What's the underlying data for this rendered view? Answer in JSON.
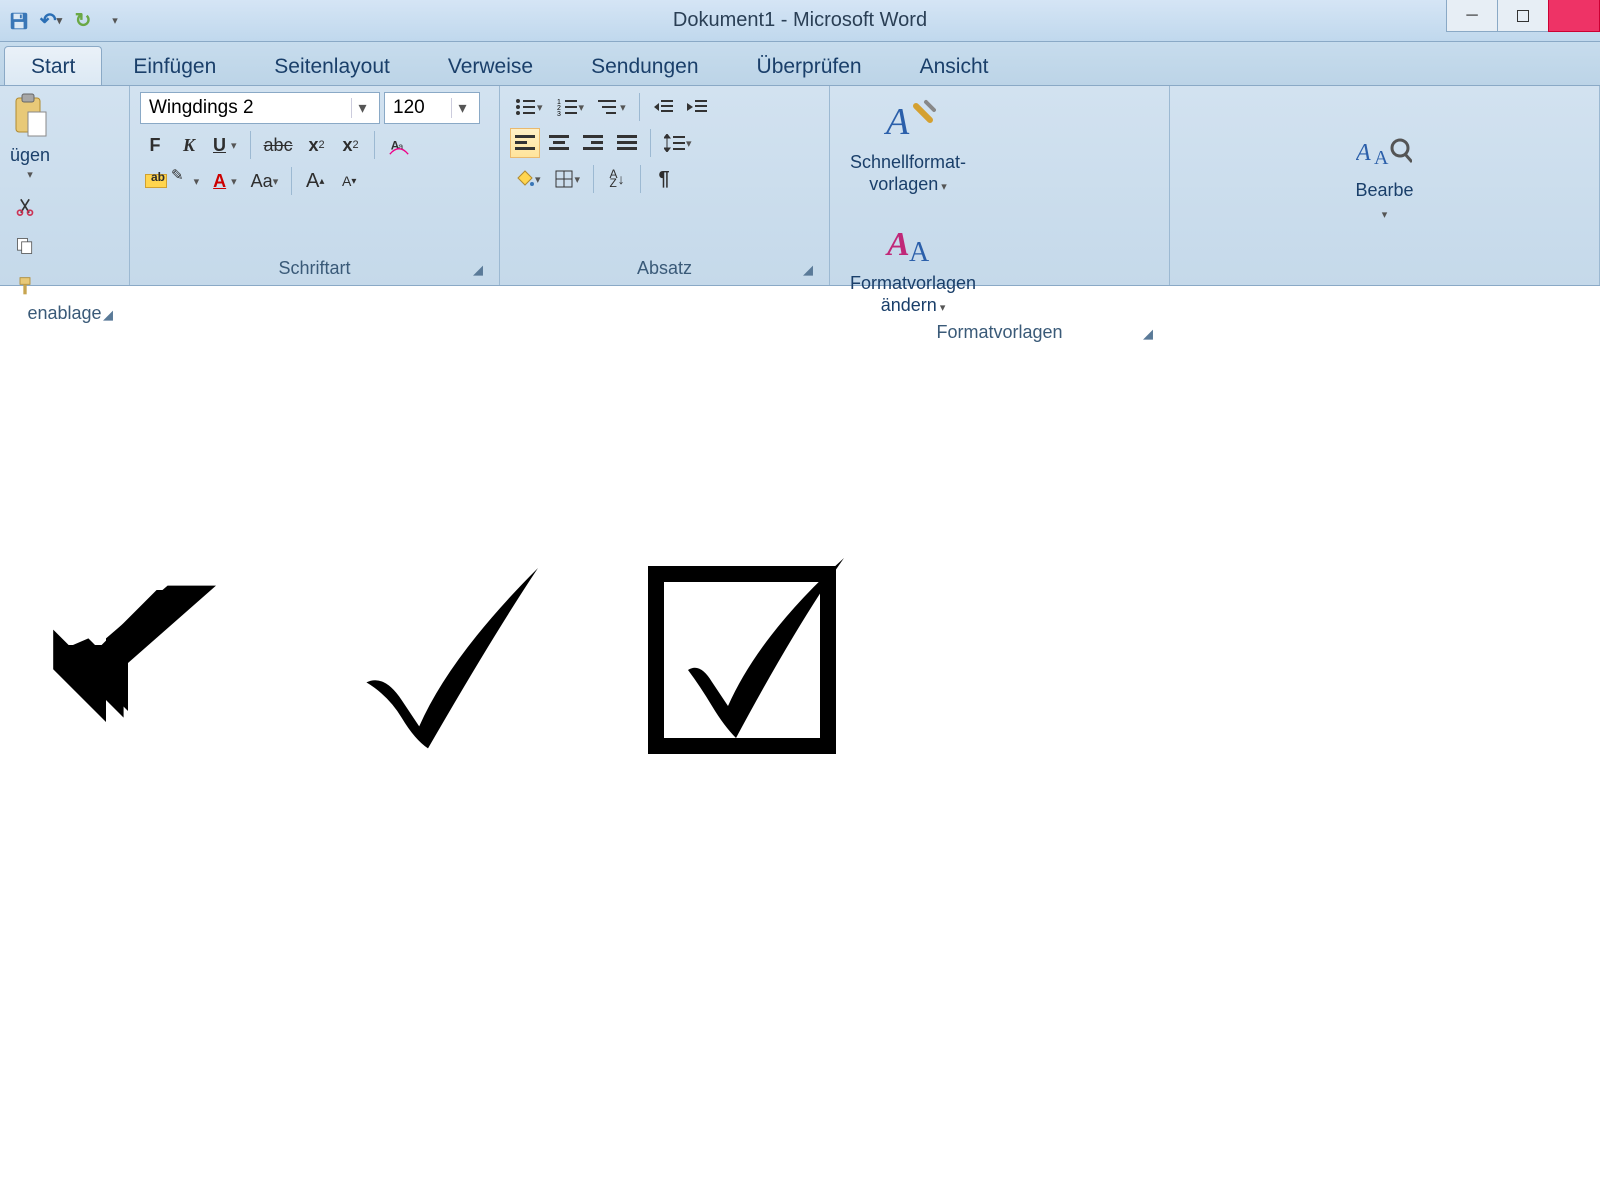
{
  "window": {
    "title": "Dokument1 - Microsoft Word"
  },
  "qat": {
    "save": "save",
    "undo": "↶",
    "redo": "↻"
  },
  "tabs": {
    "t1": "Start",
    "t2": "Einfügen",
    "t3": "Seitenlayout",
    "t4": "Verweise",
    "t5": "Sendungen",
    "t6": "Überprüfen",
    "t7": "Ansicht"
  },
  "clipboard": {
    "paste_caption": "ügen",
    "group": "enablage"
  },
  "font": {
    "name": "Wingdings 2",
    "size": "120",
    "bold": "F",
    "italic": "K",
    "underline": "U",
    "strike": "abc",
    "sub": "x",
    "sup": "x",
    "clearfmt": "Aa",
    "highlight": "ab",
    "color": "A",
    "case": "Aa",
    "grow": "A",
    "shrink": "A",
    "group": "Schriftart"
  },
  "para": {
    "bul": "bullets",
    "num": "numbering",
    "ml": "multilevel",
    "dec": "decrease-indent",
    "inc": "increase-indent",
    "al": "align-left",
    "ac": "align-center",
    "ar": "align-right",
    "aj": "align-justify",
    "ls": "line-spacing",
    "fill": "shading",
    "border": "borders",
    "sort": "sort",
    "sortlbl": "A\nZ",
    "pil": "¶",
    "group": "Absatz"
  },
  "styles": {
    "quick_l1": "Schnellformat-",
    "quick_l2": "vorlagen",
    "change_l1": "Formatvorlagen",
    "change_l2": "ändern",
    "group": "Formatvorlagen"
  },
  "edit": {
    "label": "Bearbe"
  },
  "doc": {
    "glyph1": "heavy-check",
    "glyph2": "check",
    "glyph3": "checkbox"
  }
}
